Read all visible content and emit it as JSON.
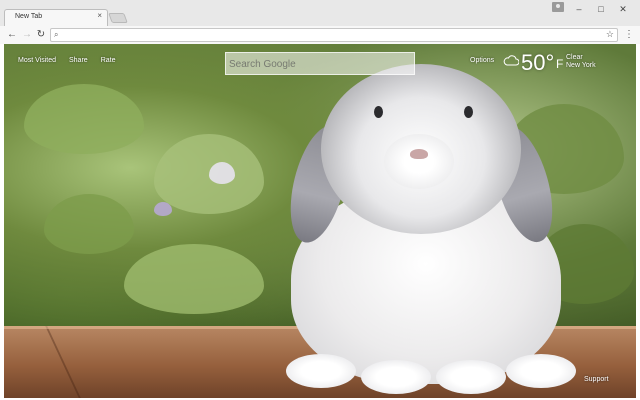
{
  "browser": {
    "tab_title": "New Tab",
    "tab_close": "×",
    "window": {
      "minimize": "–",
      "maximize": "□",
      "close": "✕"
    },
    "nav": {
      "back": "←",
      "forward": "→",
      "reload": "↻"
    },
    "omnibox": {
      "value": "",
      "placeholder": ""
    },
    "menu_glyph": "⋮",
    "star_glyph": "☆",
    "search_glyph": "⌕"
  },
  "page": {
    "nav_links": [
      "Most Visited",
      "Share",
      "Rate"
    ],
    "search": {
      "placeholder": "Search Google"
    },
    "options_label": "Options",
    "weather": {
      "icon": "cloud-icon",
      "temperature": "50°",
      "unit": "F",
      "condition": "Clear",
      "location": "New York"
    },
    "support_label": "Support"
  }
}
